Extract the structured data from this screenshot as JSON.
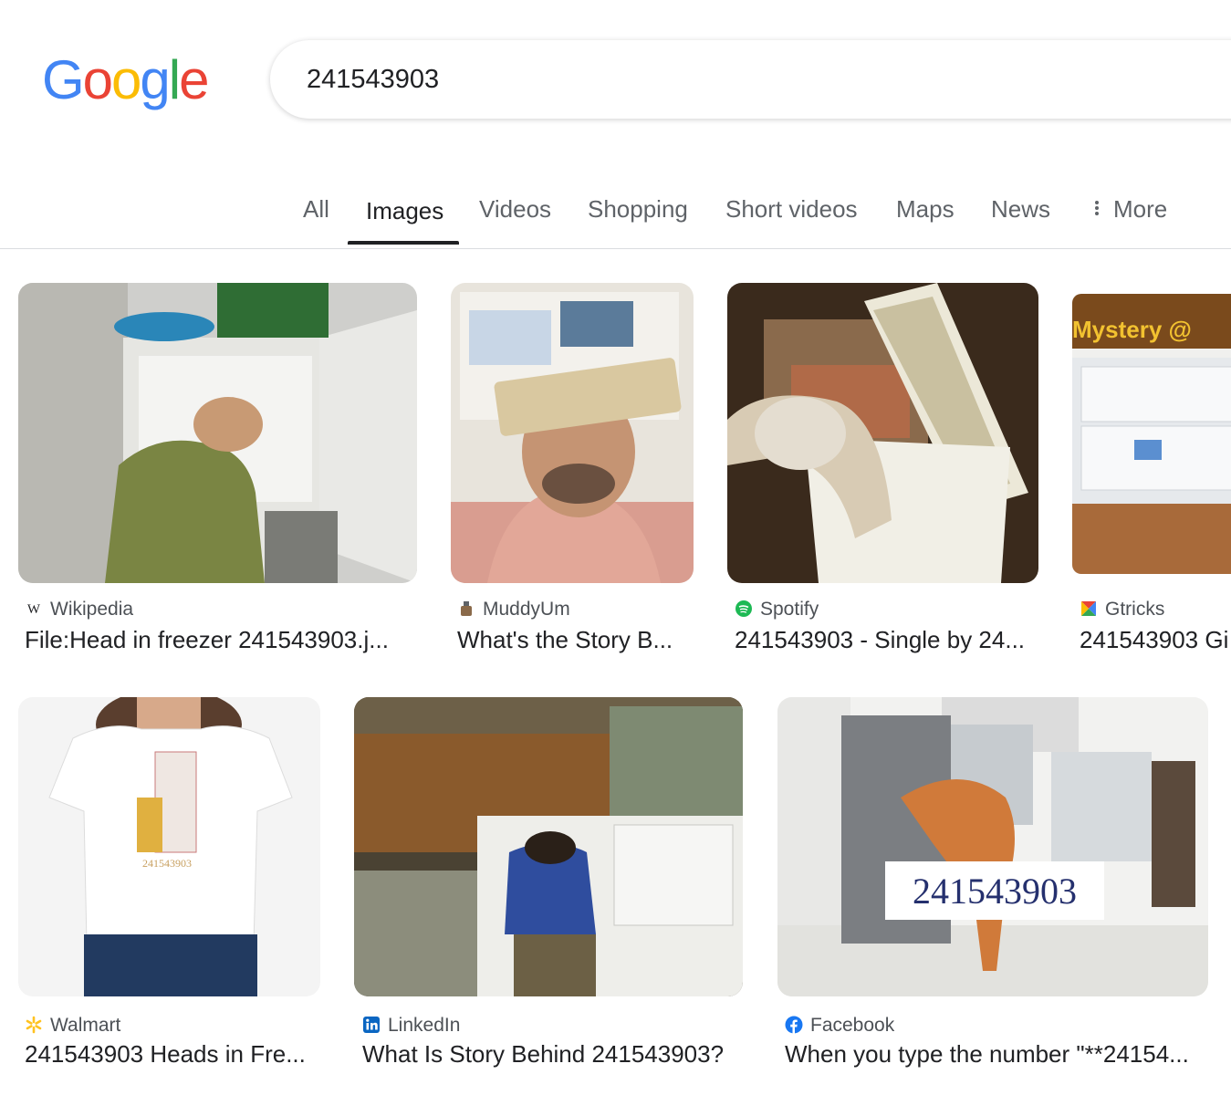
{
  "search": {
    "query": "241543903"
  },
  "logo": {
    "text": "Google",
    "letters": [
      "G",
      "o",
      "o",
      "g",
      "l",
      "e"
    ],
    "colors": [
      "#4285F4",
      "#EA4335",
      "#FBBC05",
      "#4285F4",
      "#34A853",
      "#EA4335"
    ]
  },
  "tabs": [
    "All",
    "Images",
    "Videos",
    "Shopping",
    "Short videos",
    "Maps",
    "News",
    "More"
  ],
  "active_tab": "Images",
  "results": [
    {
      "source": "Wikipedia",
      "title": "File:Head in freezer 241543903.j...",
      "icon": "wikipedia-icon"
    },
    {
      "source": "MuddyUm",
      "title": "What's the Story B...",
      "icon": "muddyum-icon"
    },
    {
      "source": "Spotify",
      "title": "241543903 - Single by 24...",
      "icon": "spotify-icon"
    },
    {
      "source": "Gtricks",
      "title": "241543903 Gi",
      "icon": "gtricks-icon",
      "image_text": "Mystery @"
    },
    {
      "source": "Walmart",
      "title": "241543903 Heads in Fre...",
      "icon": "walmart-icon",
      "image_text": "241543903"
    },
    {
      "source": "LinkedIn",
      "title": "What Is Story Behind 241543903?",
      "icon": "linkedin-icon"
    },
    {
      "source": "Facebook",
      "title": "When you type the number \"**24154...",
      "icon": "facebook-icon",
      "image_text": "241543903"
    }
  ]
}
